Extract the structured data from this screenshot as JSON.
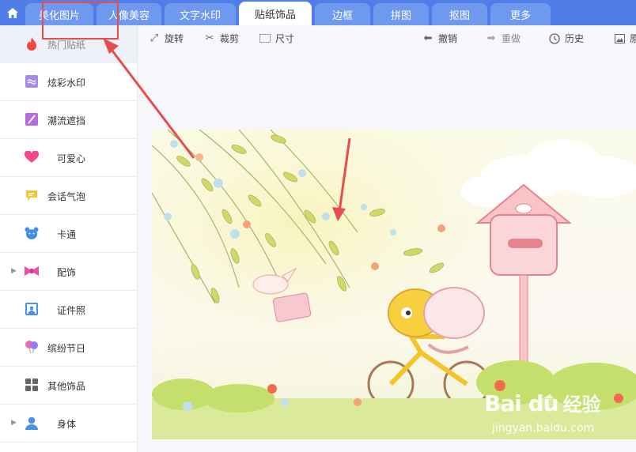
{
  "tabs": [
    {
      "label": "美化图片"
    },
    {
      "label": "人像美容"
    },
    {
      "label": "文字水印"
    },
    {
      "label": "贴纸饰品"
    },
    {
      "label": "边框"
    },
    {
      "label": "拼图"
    },
    {
      "label": "抠图"
    },
    {
      "label": "更多"
    }
  ],
  "sidebar": {
    "items": [
      {
        "label": "热门贴纸",
        "icon": "flame-icon"
      },
      {
        "label": "炫彩水印",
        "icon": "watermark-icon"
      },
      {
        "label": "潮流遮挡",
        "icon": "slash-icon"
      },
      {
        "label": "可爱心",
        "icon": "heart-icon"
      },
      {
        "label": "会话气泡",
        "icon": "speech-bubble-icon"
      },
      {
        "label": "卡通",
        "icon": "bear-icon"
      },
      {
        "label": "配饰",
        "icon": "bow-icon"
      },
      {
        "label": "证件照",
        "icon": "id-photo-icon"
      },
      {
        "label": "缤纷节日",
        "icon": "balloon-icon"
      },
      {
        "label": "其他饰品",
        "icon": "grid-icon"
      },
      {
        "label": "身体",
        "icon": "person-icon"
      }
    ]
  },
  "toolbar": {
    "rotate": "旋转",
    "crop": "裁剪",
    "size": "尺寸",
    "undo": "撤销",
    "redo": "重做",
    "history": "历史",
    "original": "原"
  },
  "watermark": {
    "logo": "Bai du",
    "name": "经验",
    "url": "jingyan.baidu.com"
  },
  "colors": {
    "tab_bar": "#4f7ee8",
    "tab": "#6f98ef",
    "annotation_red": "#e84c4c"
  }
}
